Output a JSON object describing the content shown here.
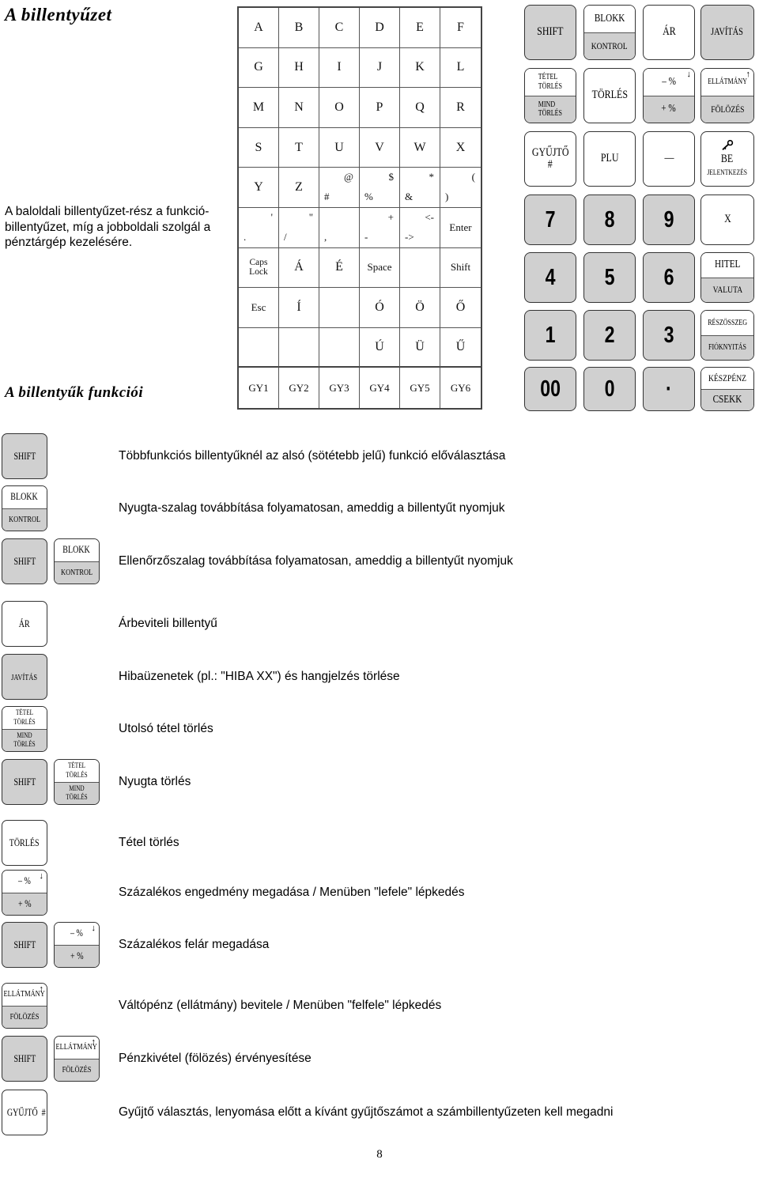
{
  "page": {
    "title": "A billentyűzet",
    "section_title": "A billentyűk funkciói",
    "intro": "A baloldali billentyűzet-rész a funkció-billentyűzet, míg a jobboldali szolgál a pénztárgép kezelésére.",
    "page_number": "8"
  },
  "char_grid": {
    "rows": [
      [
        {
          "main": "A"
        },
        {
          "main": "B"
        },
        {
          "main": "C"
        },
        {
          "main": "D"
        },
        {
          "main": "E"
        },
        {
          "main": "F"
        }
      ],
      [
        {
          "main": "G"
        },
        {
          "main": "H"
        },
        {
          "main": "I"
        },
        {
          "main": "J"
        },
        {
          "main": "K"
        },
        {
          "main": "L"
        }
      ],
      [
        {
          "main": "M"
        },
        {
          "main": "N"
        },
        {
          "main": "O"
        },
        {
          "main": "P"
        },
        {
          "main": "Q"
        },
        {
          "main": "R"
        }
      ],
      [
        {
          "main": "S"
        },
        {
          "main": "T"
        },
        {
          "main": "U"
        },
        {
          "main": "V"
        },
        {
          "main": "W"
        },
        {
          "main": "X"
        }
      ],
      [
        {
          "main": "Y"
        },
        {
          "main": "Z"
        },
        {
          "lo": "#",
          "hi": "@"
        },
        {
          "lo": "%",
          "hi": "$"
        },
        {
          "lo": "&",
          "hi": "*"
        },
        {
          "lo": ")",
          "hi": "("
        }
      ],
      [
        {
          "lo": ".",
          "hi": "'"
        },
        {
          "lo": "/",
          "hi": "\""
        },
        {
          "lo": ",",
          "hi": ""
        },
        {
          "lo": "-",
          "hi": "+"
        },
        {
          "lo": "->",
          "hi": "<-"
        },
        {
          "main": "Enter"
        }
      ],
      [
        {
          "two": "Caps\nLock"
        },
        {
          "main": "Á"
        },
        {
          "main": "É"
        },
        {
          "main": "Space"
        },
        {
          "main": ""
        },
        {
          "main": "Shift"
        }
      ],
      [
        {
          "main": "Esc"
        },
        {
          "main": "Í"
        },
        {
          "main": ""
        },
        {
          "main": "Ó"
        },
        {
          "main": "Ö"
        },
        {
          "main": "Ő"
        }
      ],
      [
        {
          "main": ""
        },
        {
          "main": ""
        },
        {
          "main": ""
        },
        {
          "main": "Ú"
        },
        {
          "main": "Ü"
        },
        {
          "main": "Ű"
        }
      ],
      [
        {
          "main": "GY1"
        },
        {
          "main": "GY2"
        },
        {
          "main": "GY3"
        },
        {
          "main": "GY4"
        },
        {
          "main": "GY5"
        },
        {
          "main": "GY6"
        }
      ]
    ]
  },
  "keypad": {
    "keys": [
      {
        "name": "shift",
        "label": "SHIFT",
        "style": "grey"
      },
      {
        "name": "blokk-kontrol",
        "top": "BLOKK",
        "bottom": "KONTROL",
        "style": "split"
      },
      {
        "name": "ar",
        "label": "ÁR",
        "style": "plain"
      },
      {
        "name": "javitas",
        "label": "JAVÍTÁS",
        "style": "grey"
      },
      {
        "name": "tetel-mind-torles",
        "top": "TÉTEL\nTÖRLÉS",
        "bottom": "MIND\nTÖRLÉS",
        "style": "split"
      },
      {
        "name": "torles",
        "label": "TÖRLÉS",
        "style": "plain"
      },
      {
        "name": "percent",
        "top": "– %",
        "bottom": "+ %",
        "style": "split",
        "arrow": "down"
      },
      {
        "name": "ellatmany-folozes",
        "top": "ELLÁTMÁNY",
        "bottom": "FÖLÖZÉS",
        "style": "split",
        "arrow": "up"
      },
      {
        "name": "gyujto",
        "label": "GYŰJTŐ\n#",
        "style": "plain"
      },
      {
        "name": "plu",
        "label": "PLU",
        "style": "plain"
      },
      {
        "name": "minus",
        "label": "—",
        "style": "plain"
      },
      {
        "name": "bejelentkezes",
        "label": "BE\nJELENTKEZÉS",
        "style": "plain",
        "icon": "key-icon"
      },
      {
        "name": "digit-7",
        "label": "7",
        "style": "grey-num"
      },
      {
        "name": "digit-8",
        "label": "8",
        "style": "grey-num"
      },
      {
        "name": "digit-9",
        "label": "9",
        "style": "grey-num"
      },
      {
        "name": "multiply",
        "label": "X",
        "style": "plain"
      },
      {
        "name": "digit-4",
        "label": "4",
        "style": "grey-num"
      },
      {
        "name": "digit-5",
        "label": "5",
        "style": "grey-num"
      },
      {
        "name": "digit-6",
        "label": "6",
        "style": "grey-num"
      },
      {
        "name": "hitel-valuta",
        "top": "HITEL",
        "bottom": "VALUTA",
        "style": "split"
      },
      {
        "name": "digit-1",
        "label": "1",
        "style": "grey-num"
      },
      {
        "name": "digit-2",
        "label": "2",
        "style": "grey-num"
      },
      {
        "name": "digit-3",
        "label": "3",
        "style": "grey-num"
      },
      {
        "name": "reszosszeg-fioknyitas",
        "top": "RÉSZÖSSZEG",
        "bottom": "FIÓKNYITÁS",
        "style": "split"
      },
      {
        "name": "digit-00",
        "label": "00",
        "style": "grey-num"
      },
      {
        "name": "digit-0",
        "label": "0",
        "style": "grey-num"
      },
      {
        "name": "decimal-point",
        "label": "·",
        "style": "grey-num"
      },
      {
        "name": "keszpenz-csekk",
        "top": "KÉSZPÉNZ",
        "bottom": "CSEKK",
        "style": "split"
      }
    ]
  },
  "legend": [
    {
      "key1": {
        "name": "shift",
        "label": "SHIFT",
        "style": "grey"
      },
      "desc": "Többfunkciós billentyűknél az alsó (sötétebb jelű) funkció előválasztása"
    },
    {
      "key1": {
        "name": "blokk-kontrol",
        "top": "BLOKK",
        "bottom": "KONTROL",
        "style": "split"
      },
      "desc": "Nyugta-szalag továbbítása folyamatosan, ameddig a billentyűt nyomjuk"
    },
    {
      "key1": {
        "name": "shift",
        "label": "SHIFT",
        "style": "grey"
      },
      "key2": {
        "name": "blokk-kontrol",
        "top": "BLOKK",
        "bottom": "KONTROL",
        "style": "split"
      },
      "desc": "Ellenőrzőszalag továbbítása folyamatosan, ameddig a billentyűt nyomjuk"
    },
    {
      "key1": {
        "name": "ar",
        "label": "ÁR",
        "style": "plain"
      },
      "desc": "Árbeviteli billentyű"
    },
    {
      "key1": {
        "name": "javitas",
        "label": "JAVÍTÁS",
        "style": "grey"
      },
      "desc": "Hibaüzenetek (pl.: \"HIBA XX\") és hangjelzés törlése"
    },
    {
      "key1": {
        "name": "tetel-mind-torles",
        "top": "TÉTEL\nTÖRLÉS",
        "bottom": "MIND\nTÖRLÉS",
        "style": "split"
      },
      "desc": "Utolsó tétel törlés"
    },
    {
      "key1": {
        "name": "shift",
        "label": "SHIFT",
        "style": "grey"
      },
      "key2": {
        "name": "tetel-mind-torles",
        "top": "TÉTEL\nTÖRLÉS",
        "bottom": "MIND\nTÖRLÉS",
        "style": "split"
      },
      "desc": "Nyugta törlés"
    },
    {
      "key1": {
        "name": "torles",
        "label": "TÖRLÉS",
        "style": "plain"
      },
      "desc": "Tétel törlés"
    },
    {
      "key1": {
        "name": "percent",
        "top": "– %",
        "bottom": "+ %",
        "style": "split",
        "arrow": "down"
      },
      "desc": "Százalékos engedmény megadása / Menüben \"lefele\" lépkedés"
    },
    {
      "key1": {
        "name": "shift",
        "label": "SHIFT",
        "style": "grey"
      },
      "key2": {
        "name": "percent",
        "top": "– %",
        "bottom": "+ %",
        "style": "split",
        "arrow": "down"
      },
      "desc": "Százalékos felár megadása"
    },
    {
      "key1": {
        "name": "ellatmany-folozes",
        "top": "ELLÁTMÁNY",
        "bottom": "FÖLÖZÉS",
        "style": "split",
        "arrow": "up"
      },
      "desc": "Váltópénz (ellátmány) bevitele / Menüben \"felfele\" lépkedés"
    },
    {
      "key1": {
        "name": "shift",
        "label": "SHIFT",
        "style": "grey"
      },
      "key2": {
        "name": "ellatmany-folozes",
        "top": "ELLÁTMÁNY",
        "bottom": "FÖLÖZÉS",
        "style": "split",
        "arrow": "up"
      },
      "desc": "Pénzkivétel (fölözés) érvényesítése"
    },
    {
      "key1": {
        "name": "gyujto",
        "label": "GYŰJTŐ\n#",
        "style": "plain"
      },
      "desc": "Gyűjtő választás, lenyomása előtt a kívánt gyűjtőszámot a számbillentyűzeten kell megadni"
    }
  ],
  "colors": {
    "key_grey": "#d0d0d0",
    "key_border": "#333333",
    "grid_border": "#444444"
  }
}
